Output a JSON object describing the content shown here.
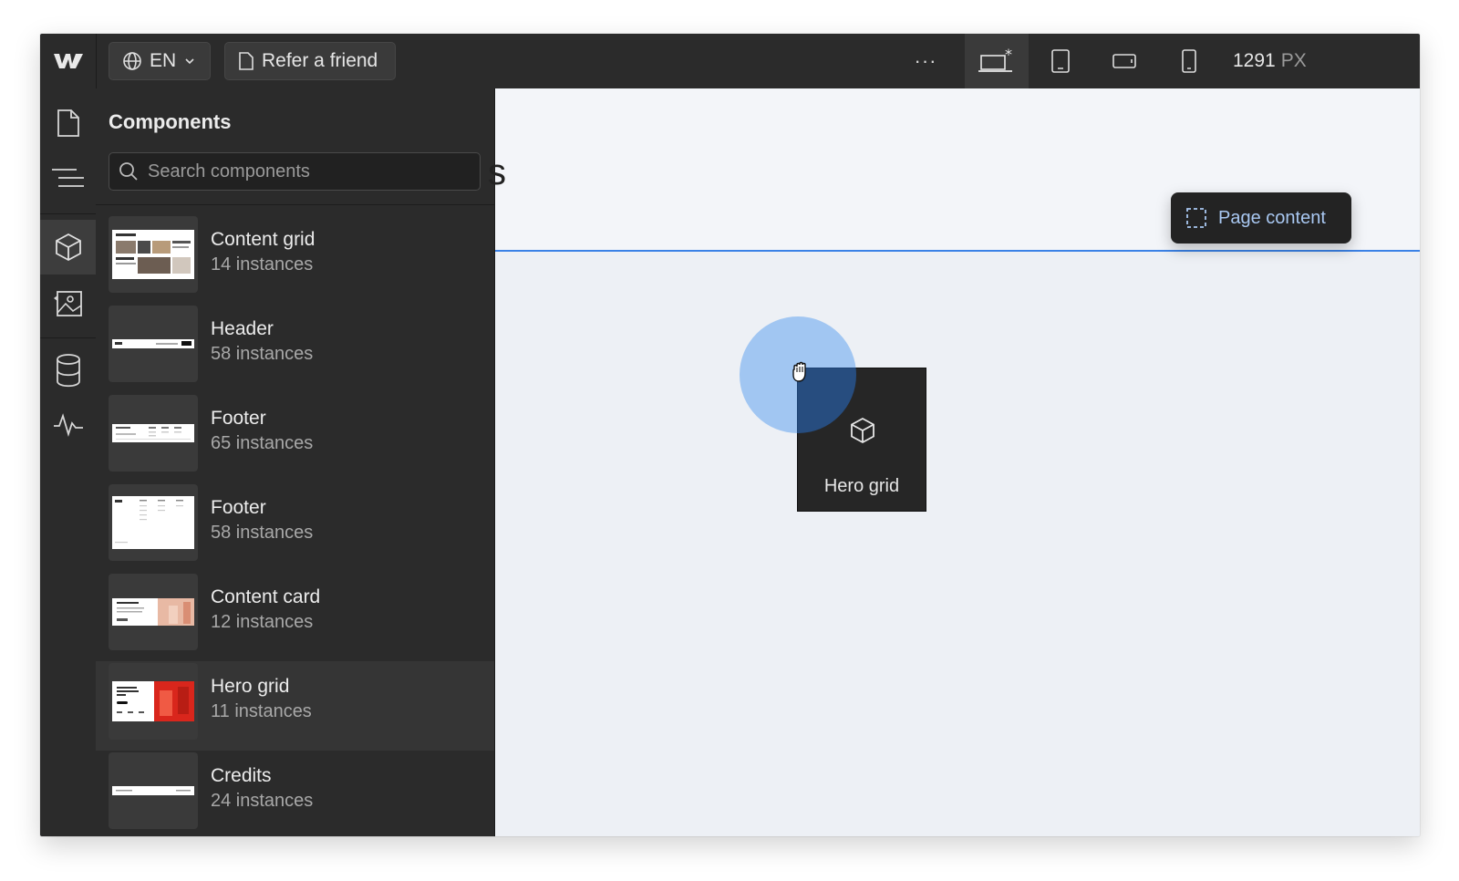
{
  "topbar": {
    "language": "EN",
    "refer_label": "Refer a friend",
    "more_label": "···",
    "breakpoint_width": "1291",
    "breakpoint_unit": "PX"
  },
  "panel": {
    "title": "Components",
    "search_placeholder": "Search components",
    "items": [
      {
        "name": "Content grid",
        "count": "14 instances"
      },
      {
        "name": "Header",
        "count": "58 instances"
      },
      {
        "name": "Footer",
        "count": "65 instances"
      },
      {
        "name": "Footer",
        "count": "58 instances"
      },
      {
        "name": "Content card",
        "count": "12 instances"
      },
      {
        "name": "Hero grid",
        "count": "11 instances"
      },
      {
        "name": "Credits",
        "count": "24 instances"
      }
    ]
  },
  "canvas": {
    "partial_heading": "s",
    "page_content_label": "Page content",
    "dragging_component": "Hero grid"
  },
  "colors": {
    "accent": "#3b82e6",
    "chip_text": "#a9c8f2",
    "ui_dark": "#2b2b2b"
  }
}
